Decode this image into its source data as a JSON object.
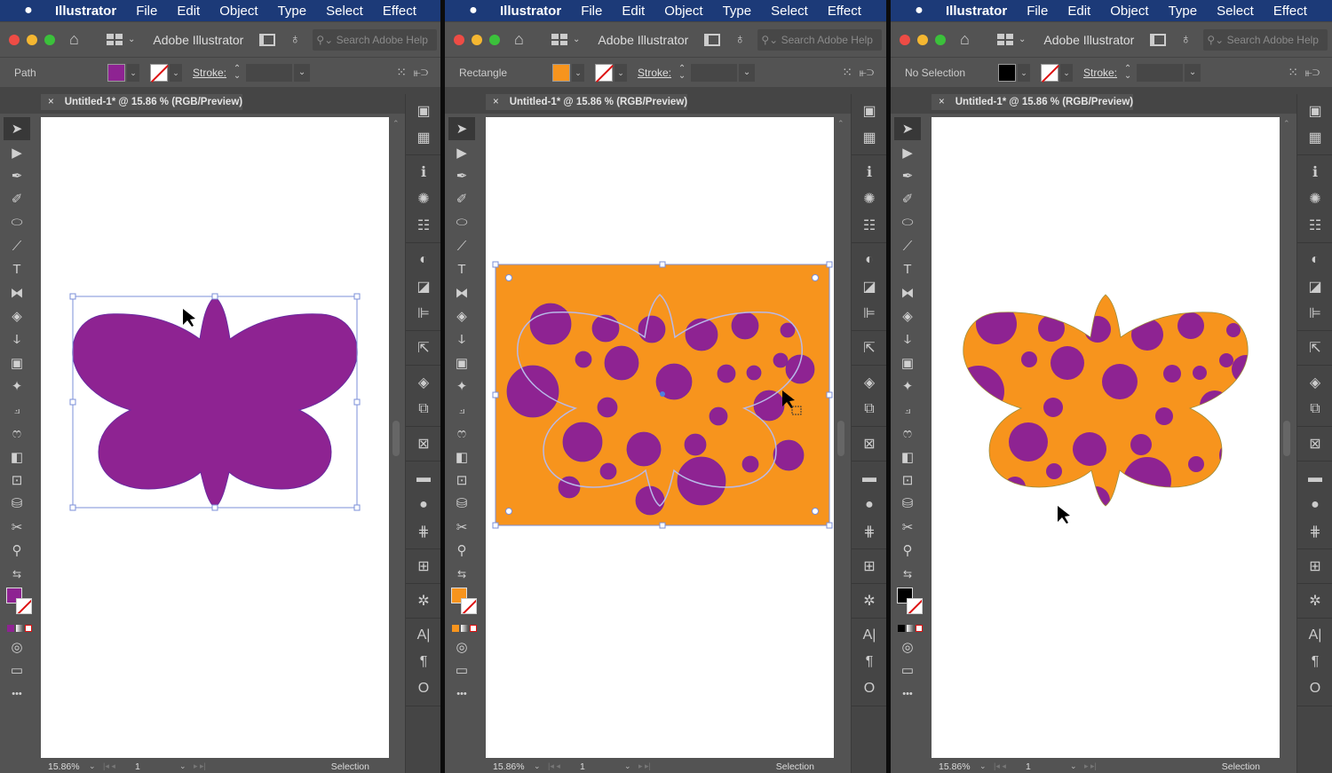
{
  "menubar": {
    "apple_icon": "apple-logo",
    "app_name": "Illustrator",
    "items": [
      "File",
      "Edit",
      "Object",
      "Type",
      "Select",
      "Effect"
    ]
  },
  "appbar": {
    "title": "Adobe Illustrator",
    "search_placeholder": "Search Adobe Help",
    "icons": [
      "home-icon",
      "workspace-switcher-icon",
      "panel-icon",
      "lightbulb-icon",
      "search-icon"
    ]
  },
  "document": {
    "tab_label": "Untitled-1* @ 15.86 % (RGB/Preview)",
    "close_label": "×"
  },
  "tools": [
    {
      "name": "selection-tool",
      "glyph": "➤"
    },
    {
      "name": "direct-selection-tool",
      "glyph": "▶"
    },
    {
      "name": "pen-tool",
      "glyph": "✒"
    },
    {
      "name": "curvature-tool",
      "glyph": "✐"
    },
    {
      "name": "ellipse-tool",
      "glyph": "⬭"
    },
    {
      "name": "paintbrush-tool",
      "glyph": "⟋"
    },
    {
      "name": "type-tool",
      "glyph": "T"
    },
    {
      "name": "reflect-tool",
      "glyph": "⧓"
    },
    {
      "name": "eraser-tool",
      "glyph": "◈"
    },
    {
      "name": "lasso-tool",
      "glyph": "ↆ"
    },
    {
      "name": "gradient-tool",
      "glyph": "▣"
    },
    {
      "name": "pin-tool",
      "glyph": "✦"
    },
    {
      "name": "eyedropper-tool",
      "glyph": "⟓"
    },
    {
      "name": "blend-tool",
      "glyph": "ෆ"
    },
    {
      "name": "shape-builder-tool",
      "glyph": "◧"
    },
    {
      "name": "artboard-tool",
      "glyph": "⊡"
    },
    {
      "name": "live-paint-tool",
      "glyph": "⛁"
    },
    {
      "name": "slice-tool",
      "glyph": "✂"
    },
    {
      "name": "zoom-tool",
      "glyph": "⚲"
    }
  ],
  "toolbar_extras": {
    "swap_icon": "⇆",
    "draw_mode_icon": "◎",
    "screen_mode_icon": "▭",
    "more_label": "•••"
  },
  "dock": {
    "groups": [
      [
        {
          "name": "properties-icon",
          "glyph": "▣"
        },
        {
          "name": "libraries-icon",
          "glyph": "▦"
        }
      ],
      [
        {
          "name": "info-icon",
          "glyph": "ℹ"
        },
        {
          "name": "color-icon",
          "glyph": "✺"
        },
        {
          "name": "adjust-icon",
          "glyph": "☷"
        }
      ],
      [
        {
          "name": "color-guide-icon",
          "glyph": "◐"
        },
        {
          "name": "transform-icon",
          "glyph": "◪"
        },
        {
          "name": "align-icon",
          "glyph": "⊫"
        }
      ],
      [
        {
          "name": "export-icon",
          "glyph": "⇱"
        }
      ],
      [
        {
          "name": "layers-icon",
          "glyph": "◈"
        },
        {
          "name": "artboards-icon",
          "glyph": "⧉"
        }
      ],
      [
        {
          "name": "asset-export-icon",
          "glyph": "⊠"
        }
      ],
      [
        {
          "name": "gradient-panel-icon",
          "glyph": "▬"
        },
        {
          "name": "transparency-icon",
          "glyph": "●"
        },
        {
          "name": "stroke-panel-icon",
          "glyph": "⋕"
        }
      ],
      [
        {
          "name": "pathfinder-icon",
          "glyph": "⊞"
        }
      ],
      [
        {
          "name": "symbols-icon",
          "glyph": "✲"
        }
      ],
      [
        {
          "name": "character-icon",
          "glyph": "A|"
        },
        {
          "name": "paragraph-icon",
          "glyph": "¶"
        },
        {
          "name": "opentype-icon",
          "glyph": "O"
        }
      ]
    ]
  },
  "colors": {
    "purple": "#8e2392",
    "orange": "#f7941d",
    "black": "#000000",
    "selection_blue": "#7b8fd9",
    "clip_outline": "#d9d46a"
  },
  "panes": [
    {
      "selection_type": "Path",
      "fill_color": "#8e2392",
      "stroke_label": "Stroke:",
      "stroke_value": "",
      "zoom": "15.86%",
      "page": "1",
      "status_tool": "Selection"
    },
    {
      "selection_type": "Rectangle",
      "fill_color": "#f7941d",
      "stroke_label": "Stroke:",
      "stroke_value": "",
      "zoom": "15.86%",
      "page": "1",
      "status_tool": "Selection"
    },
    {
      "selection_type": "No Selection",
      "fill_color": "#000000",
      "stroke_label": "Stroke:",
      "stroke_value": "",
      "zoom": "15.86%",
      "page": "1",
      "status_tool": "Selection"
    }
  ],
  "artwork": {
    "pane0": "purple butterfly path selected",
    "pane1": "orange rectangle with purple polka dots overlapping butterfly outline",
    "pane2": "butterfly clipped with orange polka-dot fill"
  }
}
